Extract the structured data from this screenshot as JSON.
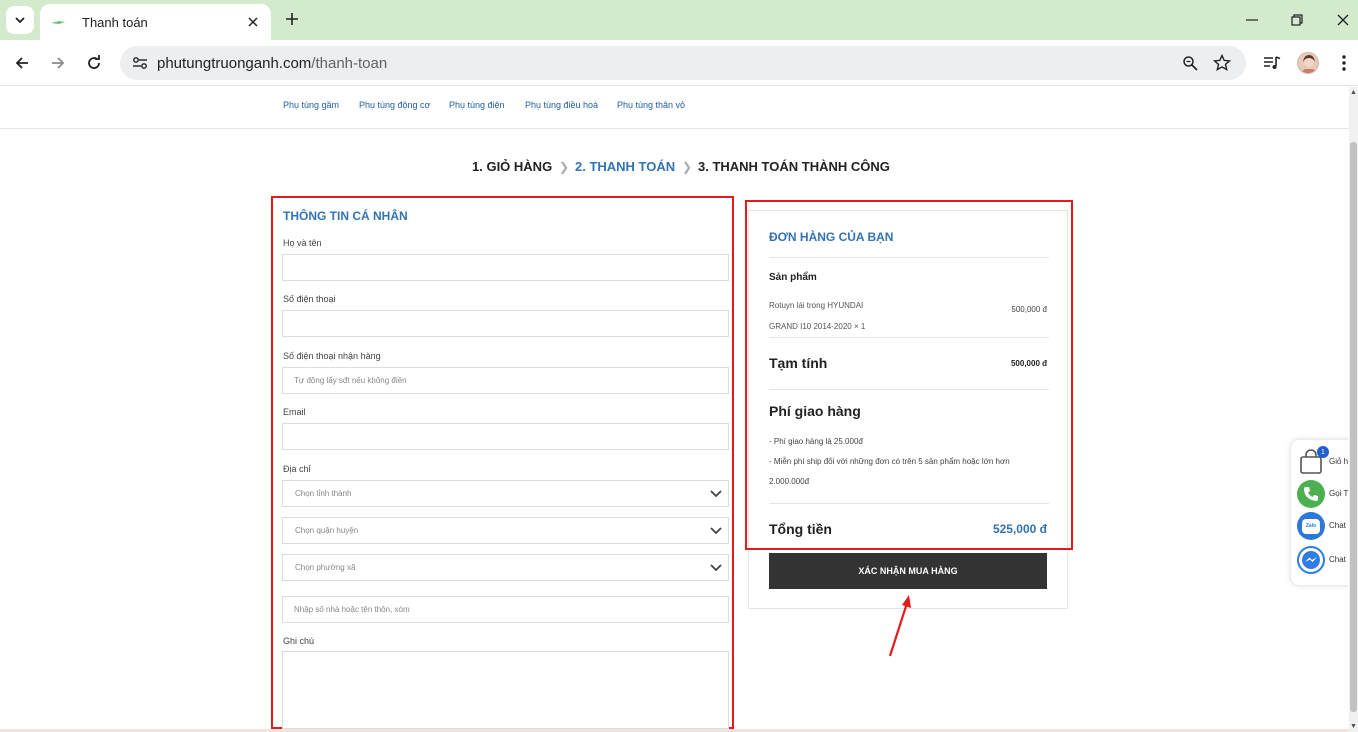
{
  "browser": {
    "tab_title": "Thanh toán",
    "url_domain": "phutungtruonganh.com",
    "url_path": "/thanh-toan"
  },
  "site_nav": [
    "Phụ tùng gầm",
    "Phụ tùng động cơ",
    "Phụ tùng điện",
    "Phụ tùng điều hoà",
    "Phụ tùng thân vỏ"
  ],
  "steps": {
    "step1": "1. GIỎ HÀNG",
    "step2": "2. THANH TOÁN",
    "step3": "3. THANH TOÁN THÀNH CÔNG"
  },
  "form": {
    "title": "THÔNG TIN CÁ NHÂN",
    "name_label": "Họ và tên",
    "phone_label": "Số điện thoại",
    "receive_phone_label": "Số điện thoại nhận hàng",
    "receive_phone_placeholder": "Tự động lấy sđt nếu không điền",
    "email_label": "Email",
    "address_label": "Địa chỉ",
    "province_placeholder": "Chọn tỉnh thành",
    "district_placeholder": "Chọn quận huyện",
    "ward_placeholder": "Chọn phường xã",
    "street_placeholder": "Nhập số nhà hoặc tên thôn, xóm",
    "note_label": "Ghi chú"
  },
  "order": {
    "title": "ĐƠN HÀNG CỦA BẠN",
    "product_header": "Sản phẩm",
    "product_line1": "Rotuyn lái trong HYUNDAI",
    "product_line2": "GRAND I10 2014-2020  × 1",
    "product_price": "500,000 đ",
    "subtotal_label": "Tạm tính",
    "subtotal_value": "500,000 đ",
    "shipping_title": "Phí giao hàng",
    "shipping_note1": "- Phí giao hàng là 25.000đ",
    "shipping_note2": "- Miễn phí ship đối với những đơn có trên 5 sản phẩm hoặc lớn hơn 2.000.000đ",
    "total_label": "Tổng tiền",
    "total_value": "525,000 đ",
    "confirm_button": "XÁC NHẬN MUA HÀNG"
  },
  "float_widget": {
    "cart_label": "Giỏ h",
    "cart_count": "1",
    "call_label": "Gọi T",
    "zalo_label": "Chat",
    "zalo_icon_text": "Zalo",
    "messenger_label": "Chat"
  },
  "colors": {
    "accent_blue": "#3173b4",
    "highlight_red": "#e31b1b",
    "button_dark": "#333333",
    "tabbar_green": "#d3eacd"
  }
}
